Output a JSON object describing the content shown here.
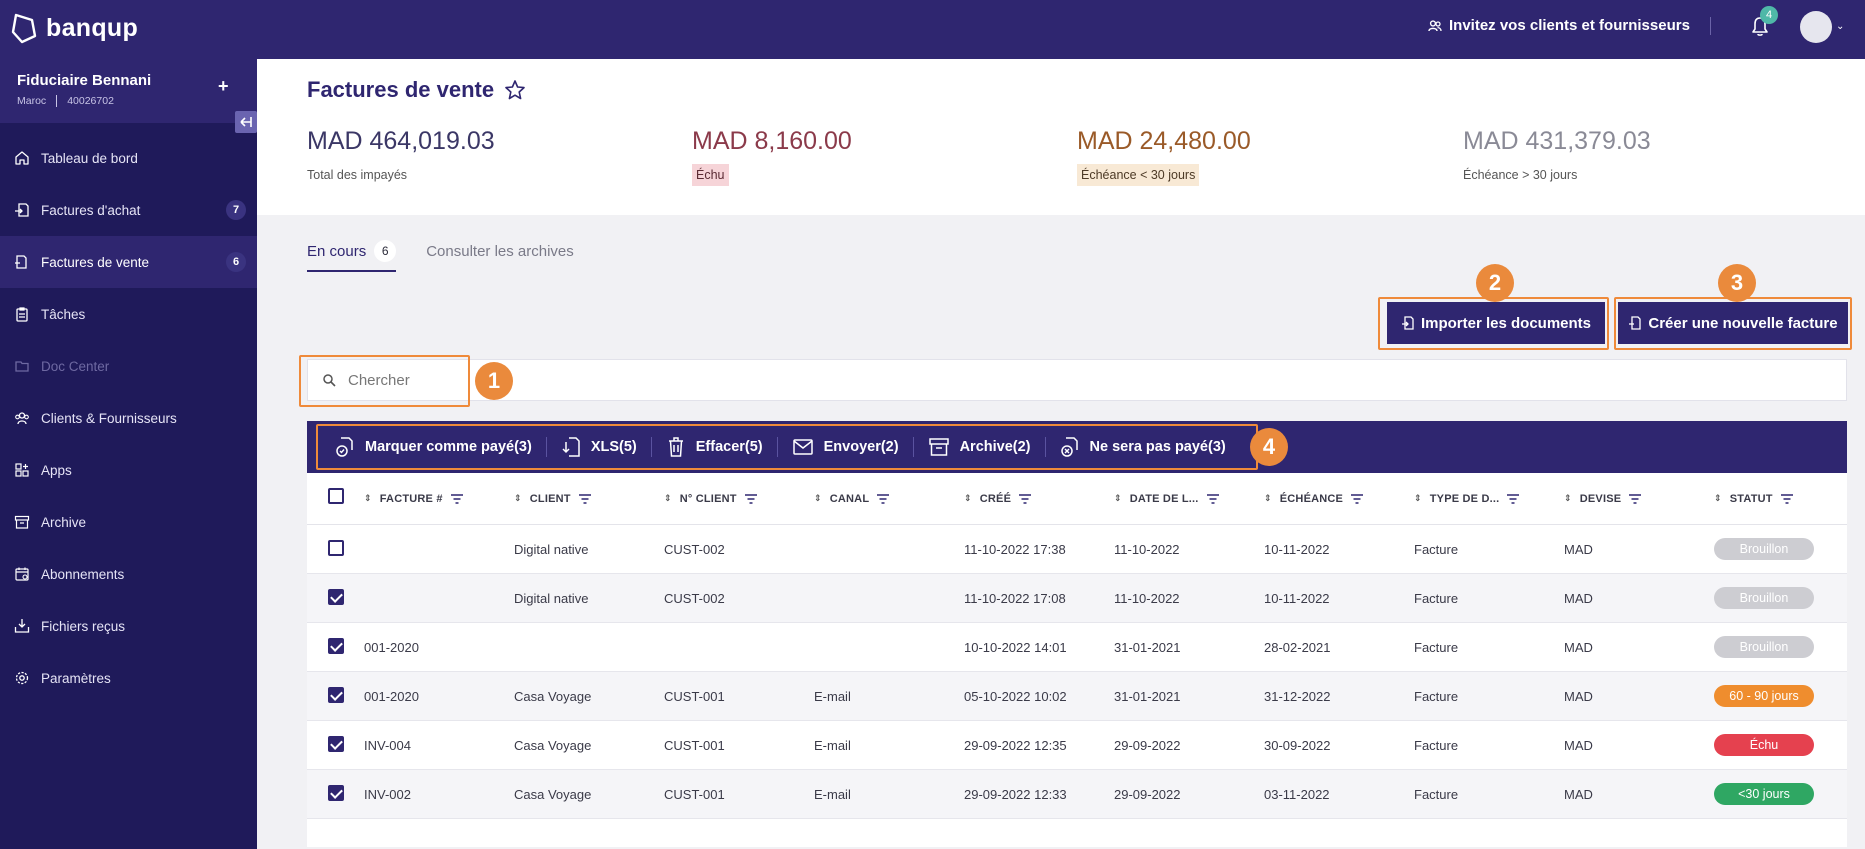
{
  "app": {
    "brand": "banqup",
    "invite_label": "Invitez vos clients et fournisseurs",
    "notification_count": "4"
  },
  "company": {
    "name": "Fiduciaire Bennani",
    "country": "Maroc",
    "id": "40026702",
    "add_label": "+"
  },
  "sidebar": {
    "items": [
      {
        "label": "Tableau de bord",
        "icon": "home-icon"
      },
      {
        "label": "Factures d'achat",
        "icon": "purchase-invoice-icon",
        "badge": "7"
      },
      {
        "label": "Factures de vente",
        "icon": "sales-invoice-icon",
        "badge": "6",
        "active": true
      },
      {
        "label": "Tâches",
        "icon": "tasks-icon"
      },
      {
        "label": "Doc Center",
        "icon": "doc-center-icon",
        "disabled": true
      },
      {
        "label": "Clients & Fournisseurs",
        "icon": "contacts-icon"
      },
      {
        "label": "Apps",
        "icon": "apps-icon"
      },
      {
        "label": "Archive",
        "icon": "archive-icon"
      },
      {
        "label": "Abonnements",
        "icon": "subscriptions-icon"
      },
      {
        "label": "Fichiers reçus",
        "icon": "received-files-icon"
      },
      {
        "label": "Paramètres",
        "icon": "settings-icon"
      }
    ]
  },
  "page": {
    "title": "Factures de vente"
  },
  "kpis": [
    {
      "amount": "MAD 464,019.03",
      "label": "Total des impayés"
    },
    {
      "amount": "MAD 8,160.00",
      "label": "Échu"
    },
    {
      "amount": "MAD 24,480.00",
      "label": "Échéance < 30 jours"
    },
    {
      "amount": "MAD 431,379.03",
      "label": "Échéance > 30 jours"
    }
  ],
  "tabs": [
    {
      "label": "En cours",
      "count": "6"
    },
    {
      "label": "Consulter les archives"
    }
  ],
  "actions": {
    "import_label": "Importer les documents",
    "create_label": "Créer une nouvelle facture"
  },
  "search": {
    "placeholder": "Chercher"
  },
  "bulk_actions": [
    {
      "label": "Marquer comme payé(3)",
      "icon": "mark-paid-icon"
    },
    {
      "label": "XLS(5)",
      "icon": "xls-export-icon"
    },
    {
      "label": "Effacer(5)",
      "icon": "trash-icon"
    },
    {
      "label": "Envoyer(2)",
      "icon": "envelope-icon"
    },
    {
      "label": "Archive(2)",
      "icon": "archive-box-icon"
    },
    {
      "label": "Ne sera pas payé(3)",
      "icon": "not-paid-icon"
    }
  ],
  "markers": [
    "1",
    "2",
    "3",
    "4"
  ],
  "table": {
    "columns": [
      "FACTURE #",
      "CLIENT",
      "N° CLIENT",
      "CANAL",
      "CRÉÉ",
      "DATE DE L...",
      "ÉCHÉANCE",
      "TYPE DE D...",
      "DEVISE",
      "STATUT"
    ],
    "rows": [
      {
        "checked": false,
        "invoice": "",
        "client": "Digital native",
        "client_no": "CUST-002",
        "channel": "",
        "created": "11-10-2022 17:38",
        "date": "11-10-2022",
        "due": "10-11-2022",
        "type": "Facture",
        "currency": "MAD",
        "status": "Brouillon",
        "status_color": "#cdcdd2"
      },
      {
        "checked": true,
        "invoice": "",
        "client": "Digital native",
        "client_no": "CUST-002",
        "channel": "",
        "created": "11-10-2022 17:08",
        "date": "11-10-2022",
        "due": "10-11-2022",
        "type": "Facture",
        "currency": "MAD",
        "status": "Brouillon",
        "status_color": "#cdcdd2"
      },
      {
        "checked": true,
        "invoice": "001-2020",
        "client": "",
        "client_no": "",
        "channel": "",
        "created": "10-10-2022 14:01",
        "date": "31-01-2021",
        "due": "28-02-2021",
        "type": "Facture",
        "currency": "MAD",
        "status": "Brouillon",
        "status_color": "#cdcdd2"
      },
      {
        "checked": true,
        "invoice": "001-2020",
        "client": "Casa Voyage",
        "client_no": "CUST-001",
        "channel": "E-mail",
        "created": "05-10-2022 10:02",
        "date": "31-01-2021",
        "due": "31-12-2022",
        "type": "Facture",
        "currency": "MAD",
        "status": "60 - 90 jours",
        "status_color": "#ef8d2e"
      },
      {
        "checked": true,
        "invoice": "INV-004",
        "client": "Casa Voyage",
        "client_no": "CUST-001",
        "channel": "E-mail",
        "created": "29-09-2022 12:35",
        "date": "29-09-2022",
        "due": "30-09-2022",
        "type": "Facture",
        "currency": "MAD",
        "status": "Échu",
        "status_color": "#e5414f"
      },
      {
        "checked": true,
        "invoice": "INV-002",
        "client": "Casa Voyage",
        "client_no": "CUST-001",
        "channel": "E-mail",
        "created": "29-09-2022 12:33",
        "date": "29-09-2022",
        "due": "03-11-2022",
        "type": "Facture",
        "currency": "MAD",
        "status": "<30 jours",
        "status_color": "#2fa763"
      }
    ]
  }
}
